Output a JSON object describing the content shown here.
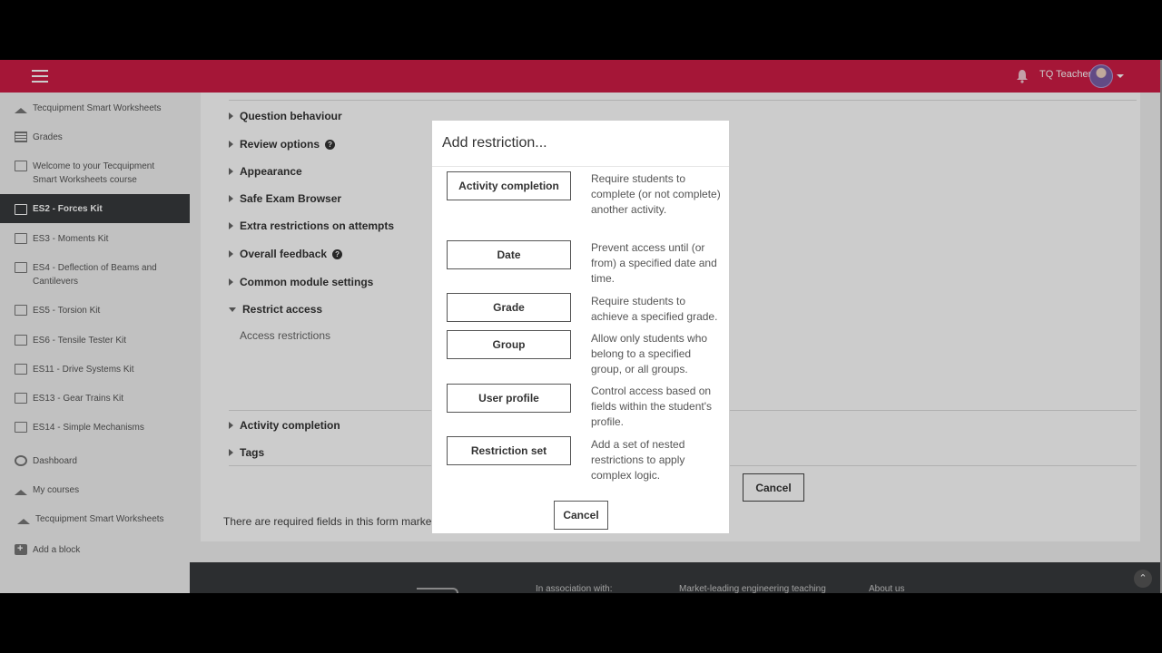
{
  "navbar": {
    "user_name": "TQ Teacher"
  },
  "drawer": {
    "items": [
      {
        "label": "Tecquipment Smart Worksheets",
        "icon": "graduation-cap-icon"
      },
      {
        "label": "Grades",
        "icon": "table-icon"
      },
      {
        "label": "Welcome to your Tecquipment Smart Worksheets course",
        "icon": "folder-icon"
      },
      {
        "label": "ES2 - Forces Kit",
        "icon": "folder-icon"
      },
      {
        "label": "ES3 - Moments Kit",
        "icon": "folder-icon"
      },
      {
        "label": "ES4 - Deflection of Beams and Cantilevers",
        "icon": "folder-icon"
      },
      {
        "label": "ES5 - Torsion Kit",
        "icon": "folder-icon"
      },
      {
        "label": "ES6 - Tensile Tester Kit",
        "icon": "folder-icon"
      },
      {
        "label": "ES11 - Drive Systems Kit",
        "icon": "folder-icon"
      },
      {
        "label": "ES13 - Gear Trains Kit",
        "icon": "folder-icon"
      },
      {
        "label": "ES14 - Simple Mechanisms",
        "icon": "folder-icon"
      },
      {
        "label": "Dashboard",
        "icon": "dashboard-icon"
      },
      {
        "label": "My courses",
        "icon": "graduation-cap-icon"
      },
      {
        "label": "Tecquipment Smart Worksheets",
        "icon": "graduation-cap-icon"
      },
      {
        "label": "Add a block",
        "icon": "plus-square-icon"
      }
    ]
  },
  "form": {
    "sections": [
      {
        "label": "Question behaviour"
      },
      {
        "label": "Review options"
      },
      {
        "label": "Appearance"
      },
      {
        "label": "Safe Exam Browser"
      },
      {
        "label": "Extra restrictions on attempts"
      },
      {
        "label": "Overall feedback"
      },
      {
        "label": "Common module settings"
      },
      {
        "label": "Restrict access"
      },
      {
        "label": "Activity completion"
      },
      {
        "label": "Tags"
      }
    ],
    "access_restrictions_label": "Access restrictions",
    "cancel_label": "Cancel",
    "required_note": "There are required fields in this form marked"
  },
  "footer": {
    "association": "In association with:",
    "tagline": "Market-leading engineering teaching",
    "about": "About us"
  },
  "modal": {
    "title": "Add restriction...",
    "options": [
      {
        "button": "Activity completion",
        "description": "Require students to complete (or not complete) another activity."
      },
      {
        "button": "Date",
        "description": "Prevent access until (or from) a specified date and time."
      },
      {
        "button": "Grade",
        "description": "Require students to achieve a specified grade."
      },
      {
        "button": "Group",
        "description": "Allow only students who belong to a specified group, or all groups."
      },
      {
        "button": "User profile",
        "description": "Control access based on fields within the student's profile."
      },
      {
        "button": "Restriction set",
        "description": "Add a set of nested restrictions to apply complex logic."
      }
    ],
    "cancel_label": "Cancel"
  },
  "colors": {
    "navbar": "#cf1c45",
    "active_item": "#373a3c"
  }
}
